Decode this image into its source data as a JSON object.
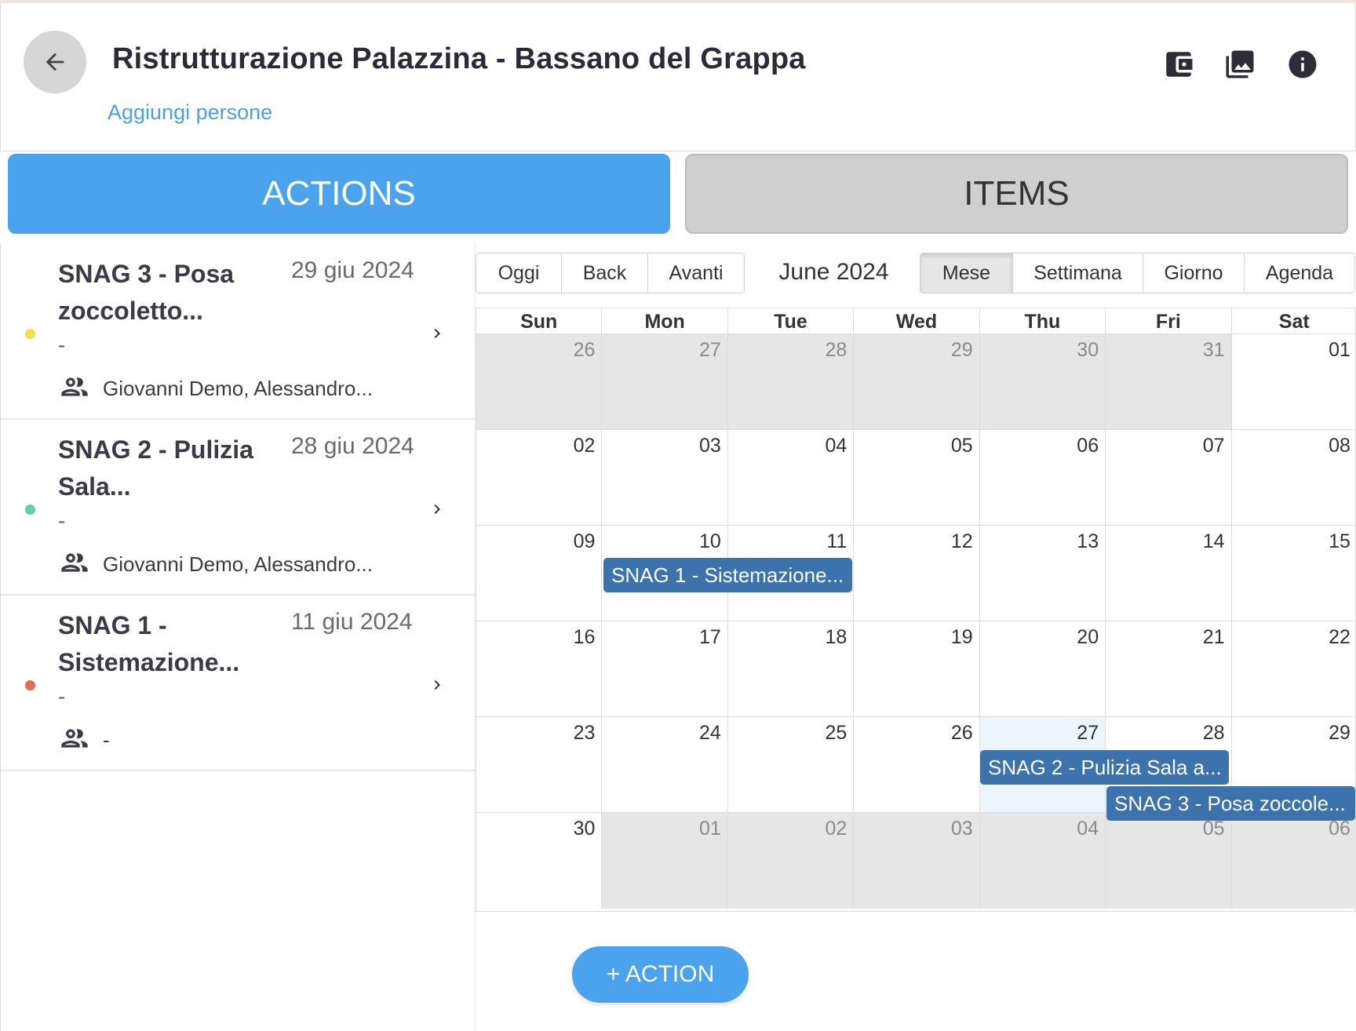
{
  "header": {
    "title": "Ristrutturazione Palazzina - Bassano del Grappa",
    "add_people": "Aggiungi persone",
    "icons": [
      "back-arrow-icon",
      "wallet-icon",
      "photo-library-icon",
      "info-icon"
    ]
  },
  "tabs": [
    {
      "label": "ACTIONS",
      "active": true
    },
    {
      "label": "ITEMS",
      "active": false
    }
  ],
  "actions": [
    {
      "title": "SNAG 3 - Posa zoccoletto...",
      "date": "29 giu 2024",
      "dash": "-",
      "people": "Giovanni Demo, Alessandro...",
      "dot_color": "#f5e04a"
    },
    {
      "title": "SNAG 2 - Pulizia Sala...",
      "date": "28 giu 2024",
      "dash": "-",
      "people": "Giovanni Demo, Alessandro...",
      "dot_color": "#5fd3a6"
    },
    {
      "title": "SNAG 1 - Sistemazione...",
      "date": "11 giu 2024",
      "dash": "-",
      "people": "-",
      "dot_color": "#e36a4e"
    }
  ],
  "calendar": {
    "nav_buttons": [
      "Oggi",
      "Back",
      "Avanti"
    ],
    "label": "June 2024",
    "views": [
      "Mese",
      "Settimana",
      "Giorno",
      "Agenda"
    ],
    "active_view": "Mese",
    "days_of_week": [
      "Sun",
      "Mon",
      "Tue",
      "Wed",
      "Thu",
      "Fri",
      "Sat"
    ],
    "weeks": [
      [
        {
          "n": "26",
          "off": true
        },
        {
          "n": "27",
          "off": true
        },
        {
          "n": "28",
          "off": true
        },
        {
          "n": "29",
          "off": true
        },
        {
          "n": "30",
          "off": true
        },
        {
          "n": "31",
          "off": true
        },
        {
          "n": "01",
          "off": false
        }
      ],
      [
        {
          "n": "02",
          "off": false
        },
        {
          "n": "03",
          "off": false
        },
        {
          "n": "04",
          "off": false
        },
        {
          "n": "05",
          "off": false
        },
        {
          "n": "06",
          "off": false
        },
        {
          "n": "07",
          "off": false
        },
        {
          "n": "08",
          "off": false
        }
      ],
      [
        {
          "n": "09",
          "off": false
        },
        {
          "n": "10",
          "off": false
        },
        {
          "n": "11",
          "off": false
        },
        {
          "n": "12",
          "off": false
        },
        {
          "n": "13",
          "off": false
        },
        {
          "n": "14",
          "off": false
        },
        {
          "n": "15",
          "off": false
        }
      ],
      [
        {
          "n": "16",
          "off": false
        },
        {
          "n": "17",
          "off": false
        },
        {
          "n": "18",
          "off": false
        },
        {
          "n": "19",
          "off": false
        },
        {
          "n": "20",
          "off": false
        },
        {
          "n": "21",
          "off": false
        },
        {
          "n": "22",
          "off": false
        }
      ],
      [
        {
          "n": "23",
          "off": false
        },
        {
          "n": "24",
          "off": false
        },
        {
          "n": "25",
          "off": false
        },
        {
          "n": "26",
          "off": false
        },
        {
          "n": "27",
          "off": false,
          "today": true
        },
        {
          "n": "28",
          "off": false
        },
        {
          "n": "29",
          "off": false
        }
      ],
      [
        {
          "n": "30",
          "off": false
        },
        {
          "n": "01",
          "off": true
        },
        {
          "n": "02",
          "off": true
        },
        {
          "n": "03",
          "off": true
        },
        {
          "n": "04",
          "off": true
        },
        {
          "n": "05",
          "off": true
        },
        {
          "n": "06",
          "off": true
        }
      ]
    ],
    "events": [
      {
        "label": "SNAG 1 - Sistemazione...",
        "start": "10",
        "end": "11"
      },
      {
        "label": "SNAG 2 - Pulizia Sala a...",
        "start": "27",
        "end": "28"
      },
      {
        "label": "SNAG 3 - Posa zoccole...",
        "start": "28",
        "end": "29"
      }
    ]
  },
  "add_action_label": "+ ACTION",
  "colors": {
    "accent": "#4aa3ec",
    "event": "#3c73ad",
    "link": "#4aa0ea"
  }
}
